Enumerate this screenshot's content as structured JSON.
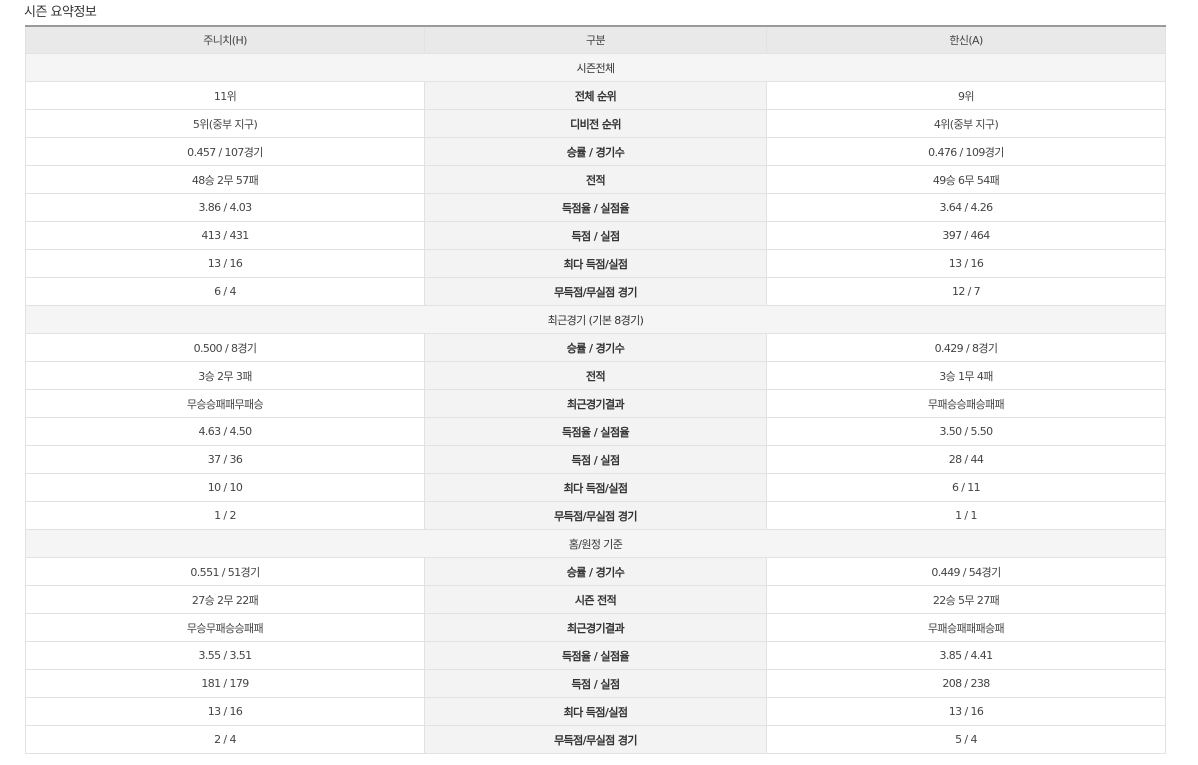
{
  "title": "시즌 요약정보",
  "header": {
    "home": "주니치(H)",
    "category": "구분",
    "away": "한신(A)"
  },
  "groups": [
    {
      "label": "시즌전체",
      "rows": [
        {
          "home": "11위",
          "label": "전체 순위",
          "away": "9위"
        },
        {
          "home": "5위(중부 지구)",
          "label": "디비전 순위",
          "away": "4위(중부 지구)"
        },
        {
          "home": "0.457 / 107경기",
          "label": "승률 / 경기수",
          "away": "0.476 / 109경기"
        },
        {
          "home": "48승 2무 57패",
          "label": "전적",
          "away": "49승 6무 54패"
        },
        {
          "home": "3.86 / 4.03",
          "label": "득점율 / 실점율",
          "away": "3.64 / 4.26"
        },
        {
          "home": "413 / 431",
          "label": "득점 / 실점",
          "away": "397 / 464"
        },
        {
          "home": "13 / 16",
          "label": "최다 득점/실점",
          "away": "13 / 16"
        },
        {
          "home": "6 / 4",
          "label": "무득점/무실점 경기",
          "away": "12 / 7"
        }
      ]
    },
    {
      "label": "최근경기 (기본 8경기)",
      "rows": [
        {
          "home": "0.500 / 8경기",
          "label": "승률 / 경기수",
          "away": "0.429 / 8경기"
        },
        {
          "home": "3승 2무 3패",
          "label": "전적",
          "away": "3승 1무 4패"
        },
        {
          "home": "무승승패패무패승",
          "label": "최근경기결과",
          "away": "무패승승패승패패"
        },
        {
          "home": "4.63 / 4.50",
          "label": "득점율 / 실점율",
          "away": "3.50 / 5.50"
        },
        {
          "home": "37 / 36",
          "label": "득점 / 실점",
          "away": "28 / 44"
        },
        {
          "home": "10 / 10",
          "label": "최다 득점/실점",
          "away": "6 / 11"
        },
        {
          "home": "1 / 2",
          "label": "무득점/무실점 경기",
          "away": "1 / 1"
        }
      ]
    },
    {
      "label": "홈/원정 기준",
      "rows": [
        {
          "home": "0.551 / 51경기",
          "label": "승률 / 경기수",
          "away": "0.449 / 54경기"
        },
        {
          "home": "27승 2무 22패",
          "label": "시즌 전적",
          "away": "22승 5무 27패"
        },
        {
          "home": "무승무패승승패패",
          "label": "최근경기결과",
          "away": "무패승패패패승패"
        },
        {
          "home": "3.55 / 3.51",
          "label": "득점율 / 실점율",
          "away": "3.85 / 4.41"
        },
        {
          "home": "181 / 179",
          "label": "득점 / 실점",
          "away": "208 / 238"
        },
        {
          "home": "13 / 16",
          "label": "최다 득점/실점",
          "away": "13 / 16"
        },
        {
          "home": "2 / 4",
          "label": "무득점/무실점 경기",
          "away": "5 / 4"
        }
      ]
    }
  ]
}
